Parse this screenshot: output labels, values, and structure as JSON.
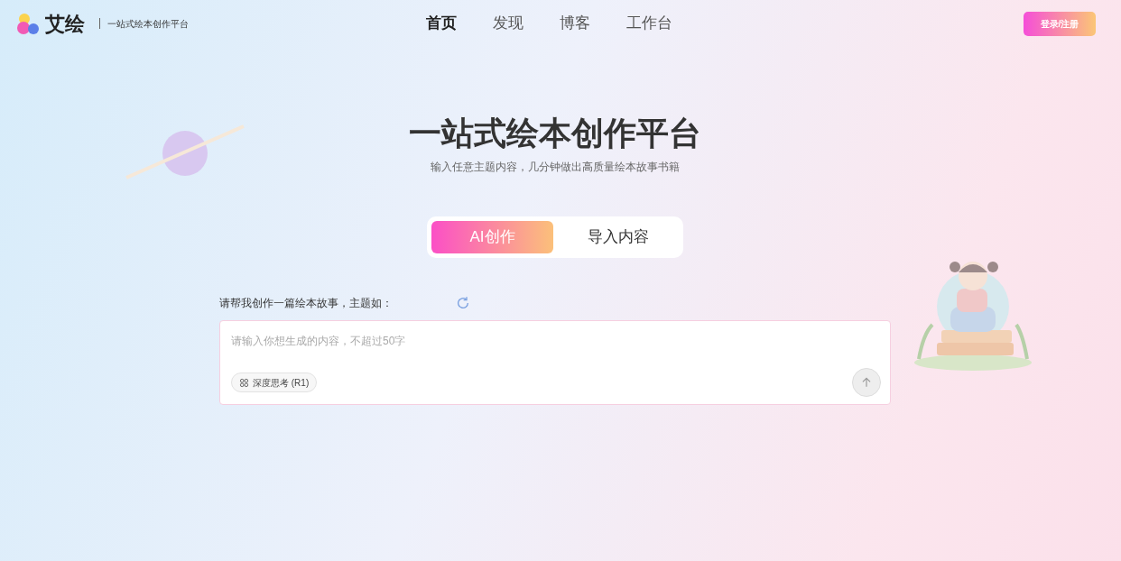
{
  "header": {
    "logo": "艾绘",
    "tagline": "一站式绘本创作平台",
    "nav": [
      {
        "label": "首页",
        "selected": true
      },
      {
        "label": "发现",
        "selected": false
      },
      {
        "label": "博客",
        "selected": false
      },
      {
        "label": "工作台",
        "selected": false
      }
    ],
    "login": "登录/注册"
  },
  "hero": {
    "title": "一站式绘本创作平台",
    "subtitle": "输入任意主题内容，几分钟做出高质量绘本故事书籍"
  },
  "modes": [
    {
      "label": "AI创作",
      "selected": true
    },
    {
      "label": "导入内容",
      "selected": false
    }
  ],
  "prompt": {
    "label": "请帮我创作一篇绘本故事，主题如：",
    "placeholder": "请输入你想生成的内容，不超过50字",
    "deep_think": {
      "label": "深度思考 (R1)",
      "on": false
    }
  }
}
